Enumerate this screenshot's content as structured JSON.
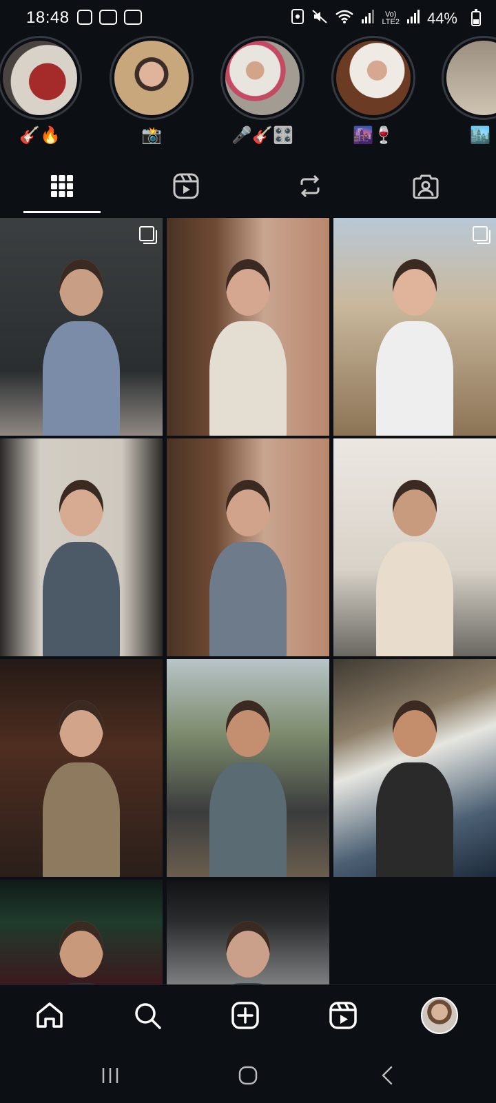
{
  "status_bar": {
    "time": "18:48",
    "signal_label_top": "Vo)",
    "signal_label_bottom": "LTE2",
    "battery_percent": "44%"
  },
  "highlights": [
    {
      "label": "🎸🔥",
      "colors": [
        "#7a1e22",
        "#c9d0d8"
      ]
    },
    {
      "label": "📸",
      "colors": [
        "#c9a77c",
        "#f0e4cf"
      ]
    },
    {
      "label": "🎤🎸🎛️",
      "colors": [
        "#a39c92",
        "#e9e6e2"
      ]
    },
    {
      "label": "🌆🍷",
      "colors": [
        "#6b3b24",
        "#d8cfc7"
      ]
    },
    {
      "label": "🏙️",
      "colors": [
        "#7d7466",
        "#cfc3b1"
      ]
    }
  ],
  "tabs": [
    {
      "name": "tab-posts-grid",
      "icon": "grid-icon",
      "active": true
    },
    {
      "name": "tab-reels",
      "icon": "reels-icon",
      "active": false
    },
    {
      "name": "tab-reposts",
      "icon": "repost-icon",
      "active": false
    },
    {
      "name": "tab-tagged",
      "icon": "tagged-icon",
      "active": false
    }
  ],
  "posts": [
    {
      "bg": "linear-gradient(180deg,#3b3f40 0%,#2a2e30 70%,#8f8883 100%)",
      "skin": "#c89e84",
      "shirt": "#7b8ca8",
      "multi": true
    },
    {
      "bg": "linear-gradient(90deg,#4a3324 0%,#6e4a34 30%,#c9a590 60%,#b9876e 100%)",
      "skin": "#d5a791",
      "shirt": "#e4ddd2",
      "multi": false
    },
    {
      "bg": "linear-gradient(180deg,#b9c8d6 0%,#c9b89c 40%,#8c7356 100%)",
      "skin": "#e0b49a",
      "shirt": "#eeeeee",
      "multi": true
    },
    {
      "bg": "linear-gradient(90deg,#2a2826 0%,#d2cdc4 25%,#cfc8be 75%,#2c2a28 100%)",
      "skin": "#d6ab92",
      "shirt": "#4c5a68",
      "multi": false
    },
    {
      "bg": "linear-gradient(90deg,#4a3324 0%,#6e4a34 30%,#c9a590 60%,#b9876e 100%)",
      "skin": "#d1a38a",
      "shirt": "#6e7b8a",
      "multi": false
    },
    {
      "bg": "linear-gradient(180deg,#ece7e1 0%,#d8d2c8 60%,#6a6862 100%)",
      "skin": "#c99b7e",
      "shirt": "#e8dccd",
      "multi": false
    },
    {
      "bg": "linear-gradient(180deg,#241a16 0%,#4e2e20 40%,#2a1f1a 100%)",
      "skin": "#d2a489",
      "shirt": "#8e7a5f",
      "multi": false
    },
    {
      "bg": "linear-gradient(180deg,#b8c4c8 0%,#7c8a6c 35%,#3a3c3c 70%,#6a5e4e 100%)",
      "skin": "#c48f70",
      "shirt": "#5a6b73",
      "multi": false
    },
    {
      "bg": "linear-gradient(160deg,#3f3a32 0%,#8d7e68 30%,#e6e6e0 45%,#4b5f73 75%,#1d2a3a 100%)",
      "skin": "#c48d6c",
      "shirt": "#2a2a2a",
      "multi": false
    },
    {
      "bg": "linear-gradient(180deg,#101a18 0%,#1f3b2c 40%,#3b1a1e 100%)",
      "skin": "#c9997c",
      "shirt": "#2d3136",
      "multi": false
    },
    {
      "bg": "linear-gradient(180deg,#101214 0%,#2a2c2e 40%,#7c7e80 100%)",
      "skin": "#caa08a",
      "shirt": "#3a4650",
      "multi": false
    }
  ],
  "bottom_nav": [
    {
      "name": "home-button",
      "icon": "home-icon"
    },
    {
      "name": "search-button",
      "icon": "search-icon"
    },
    {
      "name": "create-button",
      "icon": "add-post-icon"
    },
    {
      "name": "reels-button",
      "icon": "reels-icon"
    },
    {
      "name": "profile-button",
      "icon": "avatar"
    }
  ],
  "system_nav": [
    {
      "name": "recents-button",
      "icon": "recents-icon"
    },
    {
      "name": "home-system-button",
      "icon": "home-circle-icon"
    },
    {
      "name": "back-button",
      "icon": "back-icon"
    }
  ]
}
